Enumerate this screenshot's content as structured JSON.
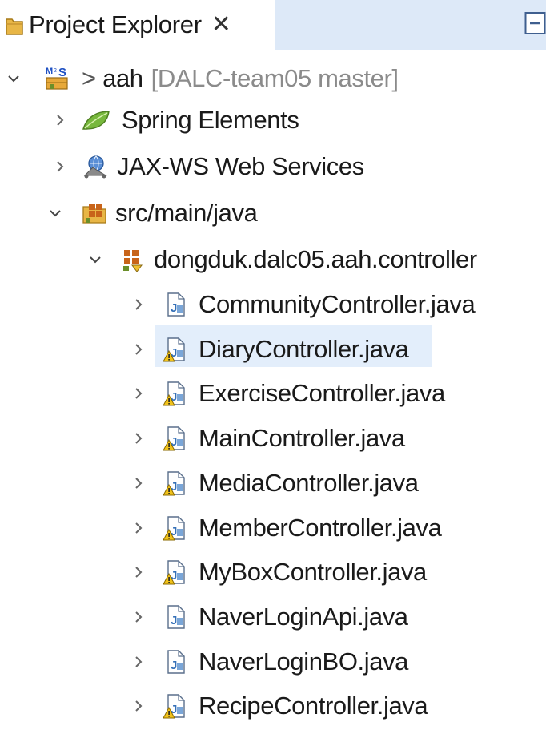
{
  "tab": {
    "title": "Project Explorer",
    "close_glyph": "✕"
  },
  "colors": {
    "tab_strip_bg": "#dde9f8",
    "view_bg": "#ffffff",
    "selection_bg": "#e3eefb",
    "decoration_text": "#8b8b8b"
  },
  "tree": {
    "project": {
      "prefix": ">",
      "name": "aah",
      "decoration": "[DALC-team05 master]",
      "icon": "maven-spring-project-icon",
      "expanded": true
    },
    "nodes": [
      {
        "label": "Spring Elements",
        "icon": "spring-leaf-icon",
        "expanded": false
      },
      {
        "label": "JAX-WS Web Services",
        "icon": "web-services-icon",
        "expanded": false
      },
      {
        "label": "src/main/java",
        "icon": "source-folder-icon",
        "expanded": true
      },
      {
        "label": "dongduk.dalc05.aah.controller",
        "icon": "package-icon",
        "expanded": true
      }
    ],
    "files": [
      {
        "label": "CommunityController.java",
        "icon": "java-file-icon",
        "warning": false
      },
      {
        "label": "DiaryController.java",
        "icon": "java-file-warning-icon",
        "warning": true,
        "selected": true
      },
      {
        "label": "ExerciseController.java",
        "icon": "java-file-warning-icon",
        "warning": true
      },
      {
        "label": "MainController.java",
        "icon": "java-file-warning-icon",
        "warning": true
      },
      {
        "label": "MediaController.java",
        "icon": "java-file-warning-icon",
        "warning": true
      },
      {
        "label": "MemberController.java",
        "icon": "java-file-warning-icon",
        "warning": true
      },
      {
        "label": "MyBoxController.java",
        "icon": "java-file-warning-icon",
        "warning": true
      },
      {
        "label": "NaverLoginApi.java",
        "icon": "java-file-icon",
        "warning": false
      },
      {
        "label": "NaverLoginBO.java",
        "icon": "java-file-icon",
        "warning": false
      },
      {
        "label": "RecipeController.java",
        "icon": "java-file-warning-icon",
        "warning": true
      }
    ]
  }
}
